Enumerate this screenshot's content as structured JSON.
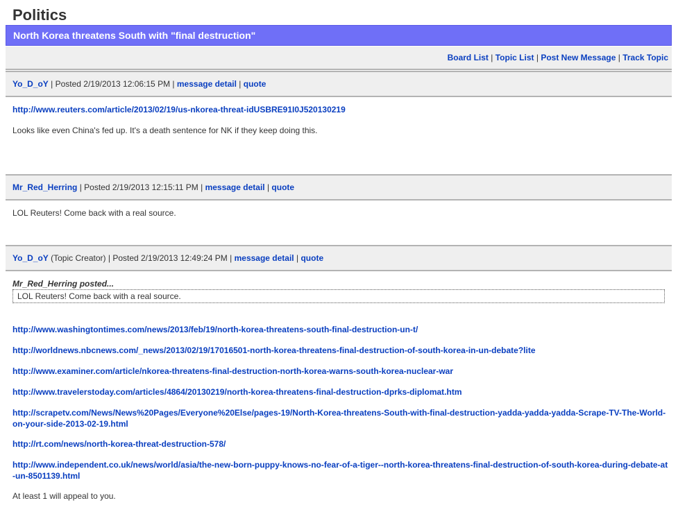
{
  "board_title": "Politics",
  "topic_title": "North Korea threatens South with \"final destruction\"",
  "nav": {
    "links": [
      "Board List",
      "Topic List",
      "Post New Message",
      "Track Topic"
    ],
    "separator": "|"
  },
  "messages": [
    {
      "author": "Yo_D_oY",
      "creator_tag": "",
      "posted": "Posted 2/19/2013 12:06:15 PM",
      "detail_label": "message detail",
      "quote_label": "quote",
      "link": "http://www.reuters.com/article/2013/02/19/us-nkorea-threat-idUSBRE91I0J520130219",
      "text": "Looks like even China's fed up. It's a death sentence for NK if they keep doing this."
    },
    {
      "author": "Mr_Red_Herring",
      "creator_tag": "",
      "posted": "Posted 2/19/2013 12:15:11 PM",
      "detail_label": "message detail",
      "quote_label": "quote",
      "text": "LOL Reuters! Come back with a real source."
    },
    {
      "author": "Yo_D_oY",
      "creator_tag": "(Topic Creator)",
      "posted": "Posted 2/19/2013 12:49:24 PM",
      "detail_label": "message detail",
      "quote_label": "quote",
      "quote_author": "Mr_Red_Herring posted...",
      "quote_text": "LOL Reuters! Come back with a real source.",
      "links": [
        "http://www.washingtontimes.com/news/2013/feb/19/north-korea-threatens-south-final-destruction-un-t/",
        "http://worldnews.nbcnews.com/_news/2013/02/19/17016501-north-korea-threatens-final-destruction-of-south-korea-in-un-debate?lite",
        "http://www.examiner.com/article/nkorea-threatens-final-destruction-north-korea-warns-south-korea-nuclear-war",
        "http://www.travelerstoday.com/articles/4864/20130219/north-korea-threatens-final-destruction-dprks-diplomat.htm",
        "http://scrapetv.com/News/News%20Pages/Everyone%20Else/pages-19/North-Korea-threatens-South-with-final-destruction-yadda-yadda-yadda-Scrape-TV-The-World-on-your-side-2013-02-19.html",
        "http://rt.com/news/north-korea-threat-destruction-578/",
        "http://www.independent.co.uk/news/world/asia/the-new-born-puppy-knows-no-fear-of-a-tiger--north-korea-threatens-final-destruction-of-south-korea-during-debate-at-un-8501139.html"
      ],
      "closing_text": "At least 1 will appeal to you."
    }
  ]
}
